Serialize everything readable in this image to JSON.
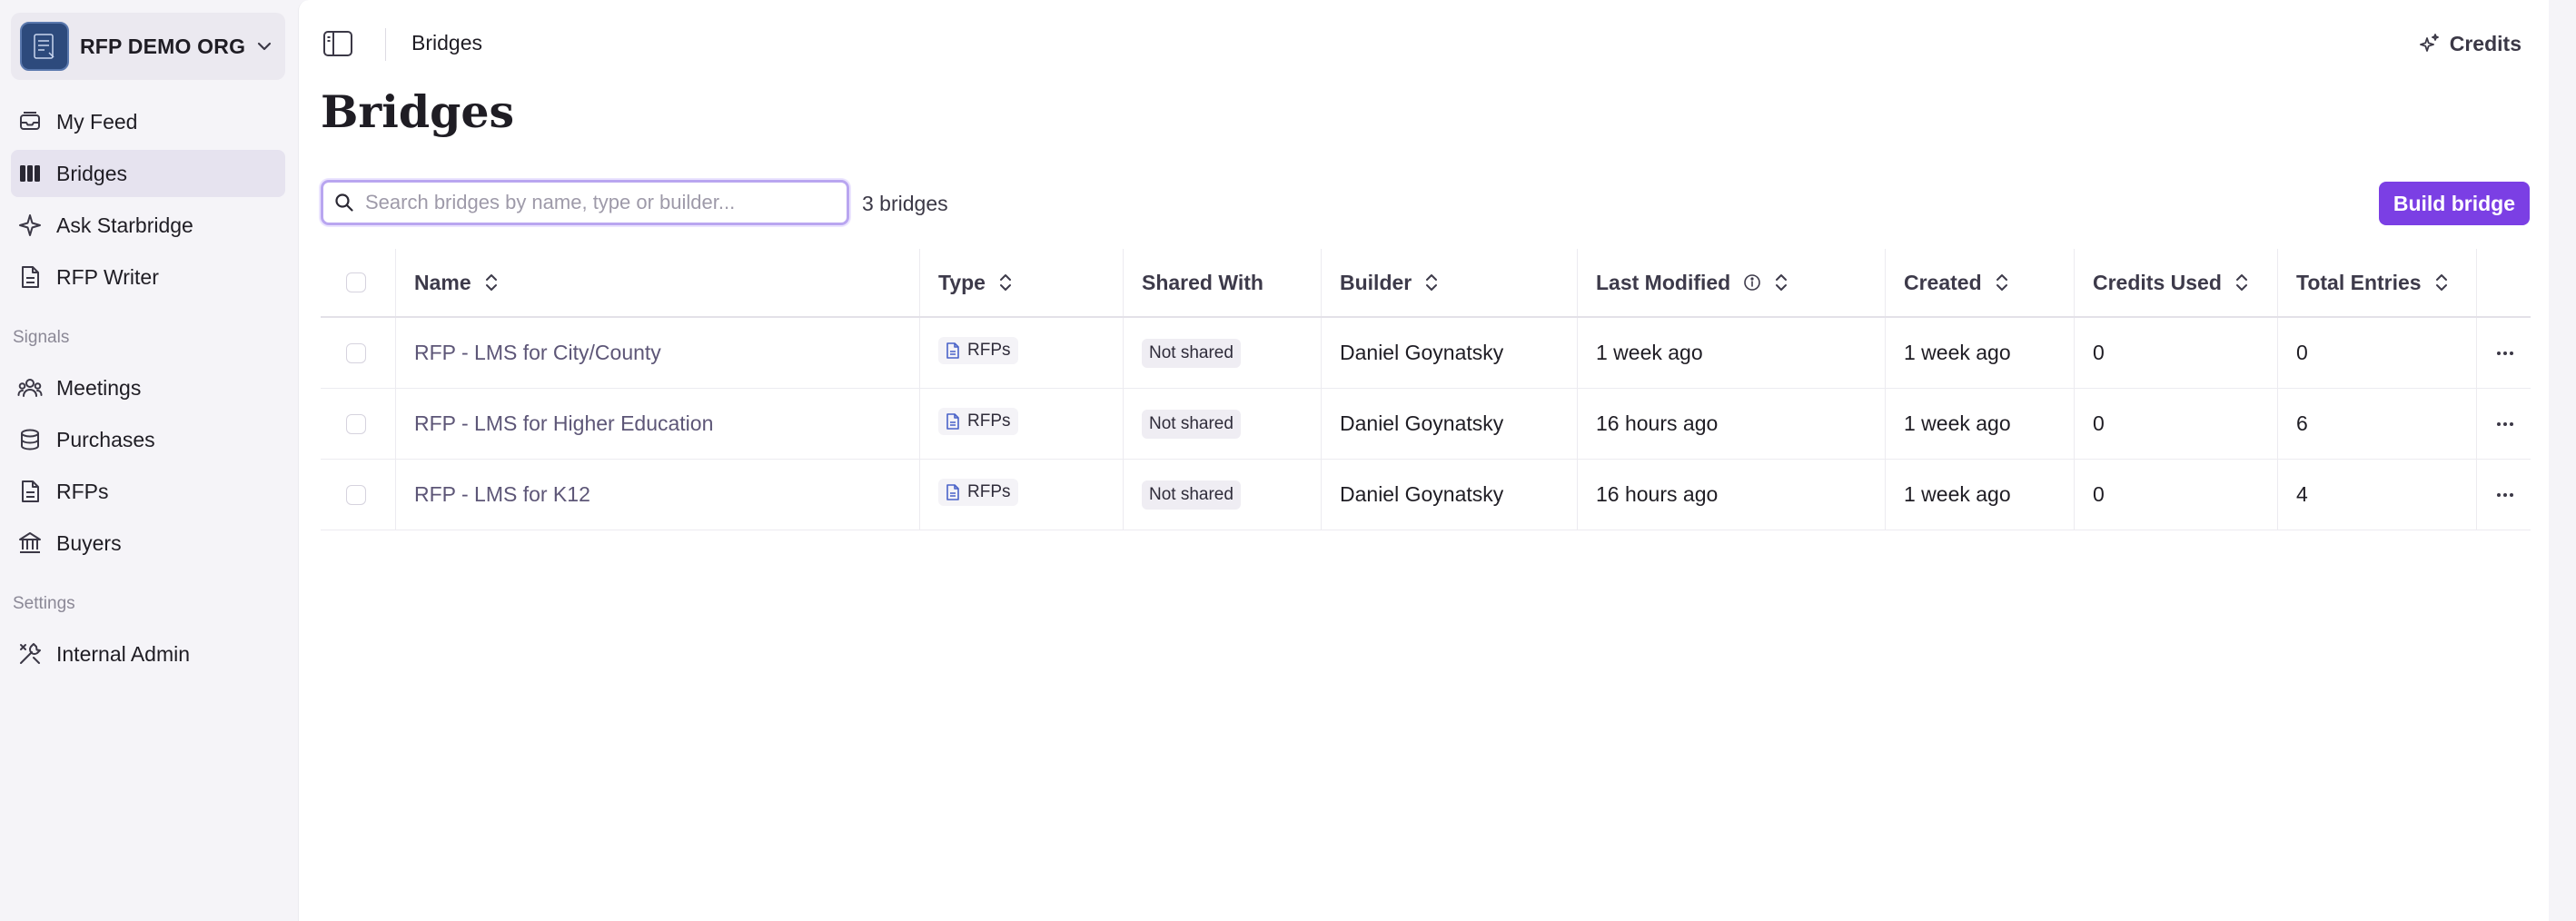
{
  "org": {
    "name": "RFP DEMO ORG"
  },
  "sidebar": {
    "primary": [
      {
        "label": "My Feed",
        "icon": "inbox-icon"
      },
      {
        "label": "Bridges",
        "icon": "columns-icon",
        "active": true
      },
      {
        "label": "Ask Starbridge",
        "icon": "sparkle-icon"
      },
      {
        "label": "RFP Writer",
        "icon": "document-icon"
      }
    ],
    "signals_heading": "Signals",
    "signals": [
      {
        "label": "Meetings",
        "icon": "people-icon"
      },
      {
        "label": "Purchases",
        "icon": "database-icon"
      },
      {
        "label": "RFPs",
        "icon": "document-icon"
      },
      {
        "label": "Buyers",
        "icon": "bank-icon"
      }
    ],
    "settings_heading": "Settings",
    "settings": [
      {
        "label": "Internal Admin",
        "icon": "tools-icon"
      }
    ]
  },
  "header": {
    "breadcrumb": "Bridges",
    "credits_label": "Credits"
  },
  "page": {
    "title": "Bridges",
    "search_placeholder": "Search bridges by name, type or builder...",
    "search_value": "",
    "count_label": "3 bridges",
    "build_button": "Build bridge"
  },
  "table": {
    "columns": {
      "name": "Name",
      "type": "Type",
      "shared": "Shared With",
      "builder": "Builder",
      "modified": "Last Modified",
      "created": "Created",
      "credits": "Credits Used",
      "entries": "Total Entries"
    },
    "rows": [
      {
        "name": "RFP - LMS for City/County",
        "type": "RFPs",
        "shared": "Not shared",
        "builder": "Daniel Goynatsky",
        "modified": "1 week ago",
        "created": "1 week ago",
        "credits": "0",
        "entries": "0"
      },
      {
        "name": "RFP - LMS for Higher Education",
        "type": "RFPs",
        "shared": "Not shared",
        "builder": "Daniel Goynatsky",
        "modified": "16 hours ago",
        "created": "1 week ago",
        "credits": "0",
        "entries": "6"
      },
      {
        "name": "RFP - LMS for K12",
        "type": "RFPs",
        "shared": "Not shared",
        "builder": "Daniel Goynatsky",
        "modified": "16 hours ago",
        "created": "1 week ago",
        "credits": "0",
        "entries": "4"
      }
    ]
  },
  "colors": {
    "accent": "#7b3fe4",
    "sidebar_bg": "#f5f4f8",
    "active_item_bg": "#e6e3ef",
    "search_focus_border": "#b9a6f0"
  }
}
